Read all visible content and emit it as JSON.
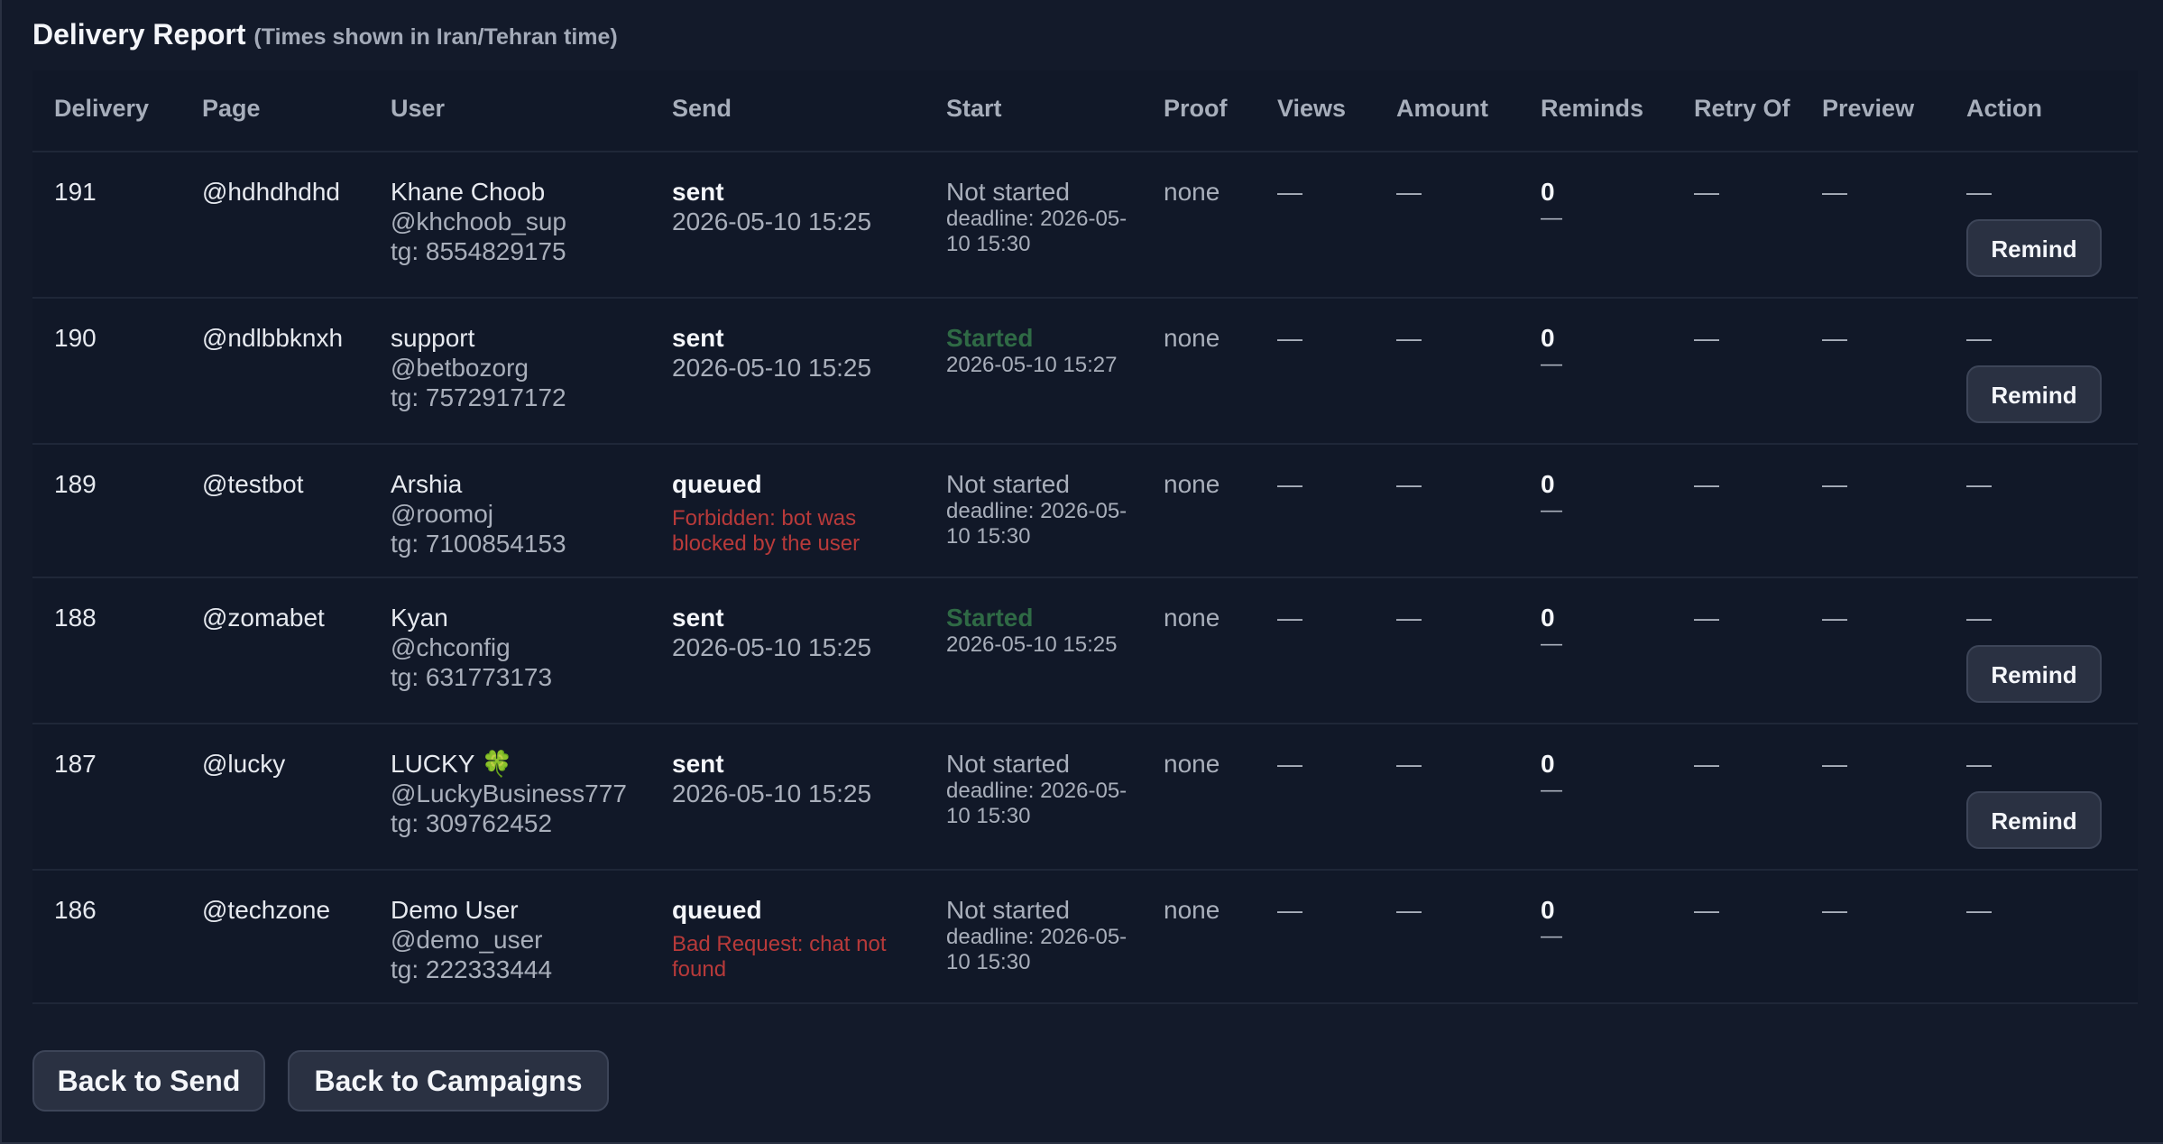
{
  "report": {
    "title": "Delivery Report",
    "subtitle": "(Times shown in Iran/Tehran time)"
  },
  "columns": {
    "delivery": "Delivery",
    "page": "Page",
    "user": "User",
    "send": "Send",
    "start": "Start",
    "proof": "Proof",
    "views": "Views",
    "amount": "Amount",
    "reminds": "Reminds",
    "retry_of": "Retry Of",
    "preview": "Preview",
    "action": "Action"
  },
  "rows": [
    {
      "delivery": "191",
      "page": "@hdhdhdhd",
      "user_name": "Khane Choob",
      "user_handle": "@khchoob_sup",
      "user_tg": "tg: 8554829175",
      "send_status": "sent",
      "send_detail": "2026-05-10 15:25",
      "start_status": "Not started",
      "start_detail": "deadline: 2026-05-10 15:30",
      "proof": "none",
      "views": "—",
      "amount": "—",
      "reminds_count": "0",
      "reminds_detail": "—",
      "retry_of": "—",
      "preview": "—",
      "action": "—",
      "remind_label": "Remind"
    },
    {
      "delivery": "190",
      "page": "@ndlbbknxh",
      "user_name": "support",
      "user_handle": "@betbozorg",
      "user_tg": "tg: 7572917172",
      "send_status": "sent",
      "send_detail": "2026-05-10 15:25",
      "start_status": "Started",
      "start_detail": "2026-05-10 15:27",
      "proof": "none",
      "views": "—",
      "amount": "—",
      "reminds_count": "0",
      "reminds_detail": "—",
      "retry_of": "—",
      "preview": "—",
      "action": "—",
      "remind_label": "Remind"
    },
    {
      "delivery": "189",
      "page": "@testbot",
      "user_name": "Arshia",
      "user_handle": "@roomoj",
      "user_tg": "tg: 7100854153",
      "send_status": "queued",
      "send_error": "Forbidden: bot was blocked by the user",
      "start_status": "Not started",
      "start_detail": "deadline: 2026-05-10 15:30",
      "proof": "none",
      "views": "—",
      "amount": "—",
      "reminds_count": "0",
      "reminds_detail": "—",
      "retry_of": "—",
      "preview": "—",
      "action": "—"
    },
    {
      "delivery": "188",
      "page": "@zomabet",
      "user_name": "Kyan",
      "user_handle": "@chconfig",
      "user_tg": "tg: 631773173",
      "send_status": "sent",
      "send_detail": "2026-05-10 15:25",
      "start_status": "Started",
      "start_detail": "2026-05-10 15:25",
      "proof": "none",
      "views": "—",
      "amount": "—",
      "reminds_count": "0",
      "reminds_detail": "—",
      "retry_of": "—",
      "preview": "—",
      "action": "—",
      "remind_label": "Remind"
    },
    {
      "delivery": "187",
      "page": "@lucky",
      "user_name": "LUCKY 🍀",
      "user_handle": "@LuckyBusiness777",
      "user_tg": "tg: 309762452",
      "send_status": "sent",
      "send_detail": "2026-05-10 15:25",
      "start_status": "Not started",
      "start_detail": "deadline: 2026-05-10 15:30",
      "proof": "none",
      "views": "—",
      "amount": "—",
      "reminds_count": "0",
      "reminds_detail": "—",
      "retry_of": "—",
      "preview": "—",
      "action": "—",
      "remind_label": "Remind"
    },
    {
      "delivery": "186",
      "page": "@techzone",
      "user_name": "Demo User",
      "user_handle": "@demo_user",
      "user_tg": "tg: 222333444",
      "send_status": "queued",
      "send_error": "Bad Request: chat not found",
      "start_status": "Not started",
      "start_detail": "deadline: 2026-05-10 15:30",
      "proof": "none",
      "views": "—",
      "amount": "—",
      "reminds_count": "0",
      "reminds_detail": "—",
      "retry_of": "—",
      "preview": "—",
      "action": "—"
    }
  ],
  "footer": {
    "back_to_send": "Back to Send",
    "back_to_campaigns": "Back to Campaigns"
  },
  "colors": {
    "background": "#131a2a",
    "started": "#2f6a45",
    "error": "#b83a3a",
    "button_bg": "#2a3142"
  }
}
